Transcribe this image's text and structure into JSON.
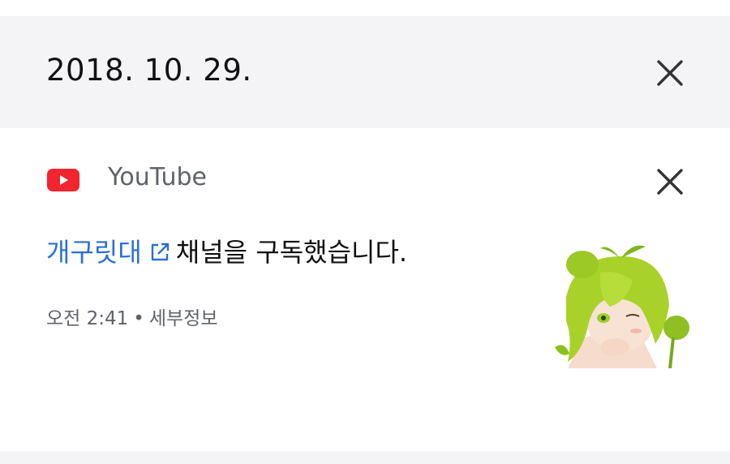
{
  "date_header": {
    "date": "2018. 10. 29.",
    "close_icon": "close-icon"
  },
  "notification": {
    "app_icon": "youtube-logo-icon",
    "app_name": "YouTube",
    "close_icon": "close-icon",
    "channel_name": "개구릿대",
    "link_icon": "external-link-icon",
    "message_suffix": "채널을 구독했습니다.",
    "time": "오전 2:41",
    "separator": "•",
    "details_label": "세부정보",
    "thumbnail": "channel-avatar-thumbnail"
  },
  "colors": {
    "header_bg": "#f4f4f7",
    "link_blue": "#2a6fd6",
    "youtube_red": "#ff0000",
    "muted_text": "#5f6368"
  }
}
